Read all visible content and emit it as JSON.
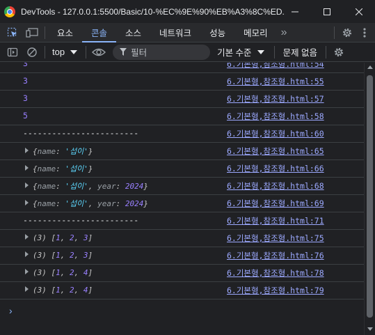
{
  "window": {
    "title": "DevTools - 127.0.0.1:5500/Basic/10-%EC%9E%90%EB%A3%8C%ED..."
  },
  "tabs": {
    "items": [
      "요소",
      "콘솔",
      "소스",
      "네트워크",
      "성능",
      "메모리"
    ],
    "active": "콘솔",
    "more": "»"
  },
  "toolbar": {
    "context": "top",
    "filter_placeholder": "필터",
    "levels": "기본 수준",
    "issues": "문제 없음"
  },
  "console": {
    "rows": [
      {
        "kind": "num",
        "text": "3",
        "source": "6.기본형,참조형.html:54"
      },
      {
        "kind": "num",
        "text": "3",
        "source": "6.기본형,참조형.html:55"
      },
      {
        "kind": "num",
        "text": "3",
        "source": "6.기본형,참조형.html:57"
      },
      {
        "kind": "num",
        "text": "5",
        "source": "6.기본형,참조형.html:58"
      },
      {
        "kind": "dash",
        "text": "------------------------",
        "source": "6.기본형,참조형.html:60"
      },
      {
        "kind": "obj",
        "name": "'섭이'",
        "source": "6.기본형,참조형.html:65"
      },
      {
        "kind": "obj",
        "name": "'섭이'",
        "source": "6.기본형,참조형.html:66"
      },
      {
        "kind": "obj2",
        "name": "'섭이'",
        "year": "2024",
        "source": "6.기본형,참조형.html:68"
      },
      {
        "kind": "obj2",
        "name": "'섭이'",
        "year": "2024",
        "source": "6.기본형,참조형.html:69"
      },
      {
        "kind": "dash",
        "text": "------------------------",
        "source": "6.기본형,참조형.html:71"
      },
      {
        "kind": "arr",
        "len": "(3)",
        "items": [
          "1",
          "2",
          "3"
        ],
        "source": "6.기본형,참조형.html:75"
      },
      {
        "kind": "arr",
        "len": "(3)",
        "items": [
          "1",
          "2",
          "3"
        ],
        "source": "6.기본형,참조형.html:76"
      },
      {
        "kind": "arr",
        "len": "(3)",
        "items": [
          "1",
          "2",
          "4"
        ],
        "source": "6.기본형,참조형.html:78"
      },
      {
        "kind": "arr",
        "len": "(3)",
        "items": [
          "1",
          "2",
          "4"
        ],
        "source": "6.기본형,참조형.html:79"
      }
    ],
    "prompt": "›"
  },
  "colors": {
    "accent": "#8ab4f8",
    "number": "#9980ff",
    "string": "#5cd5fb",
    "link": "#9ca9ff"
  }
}
